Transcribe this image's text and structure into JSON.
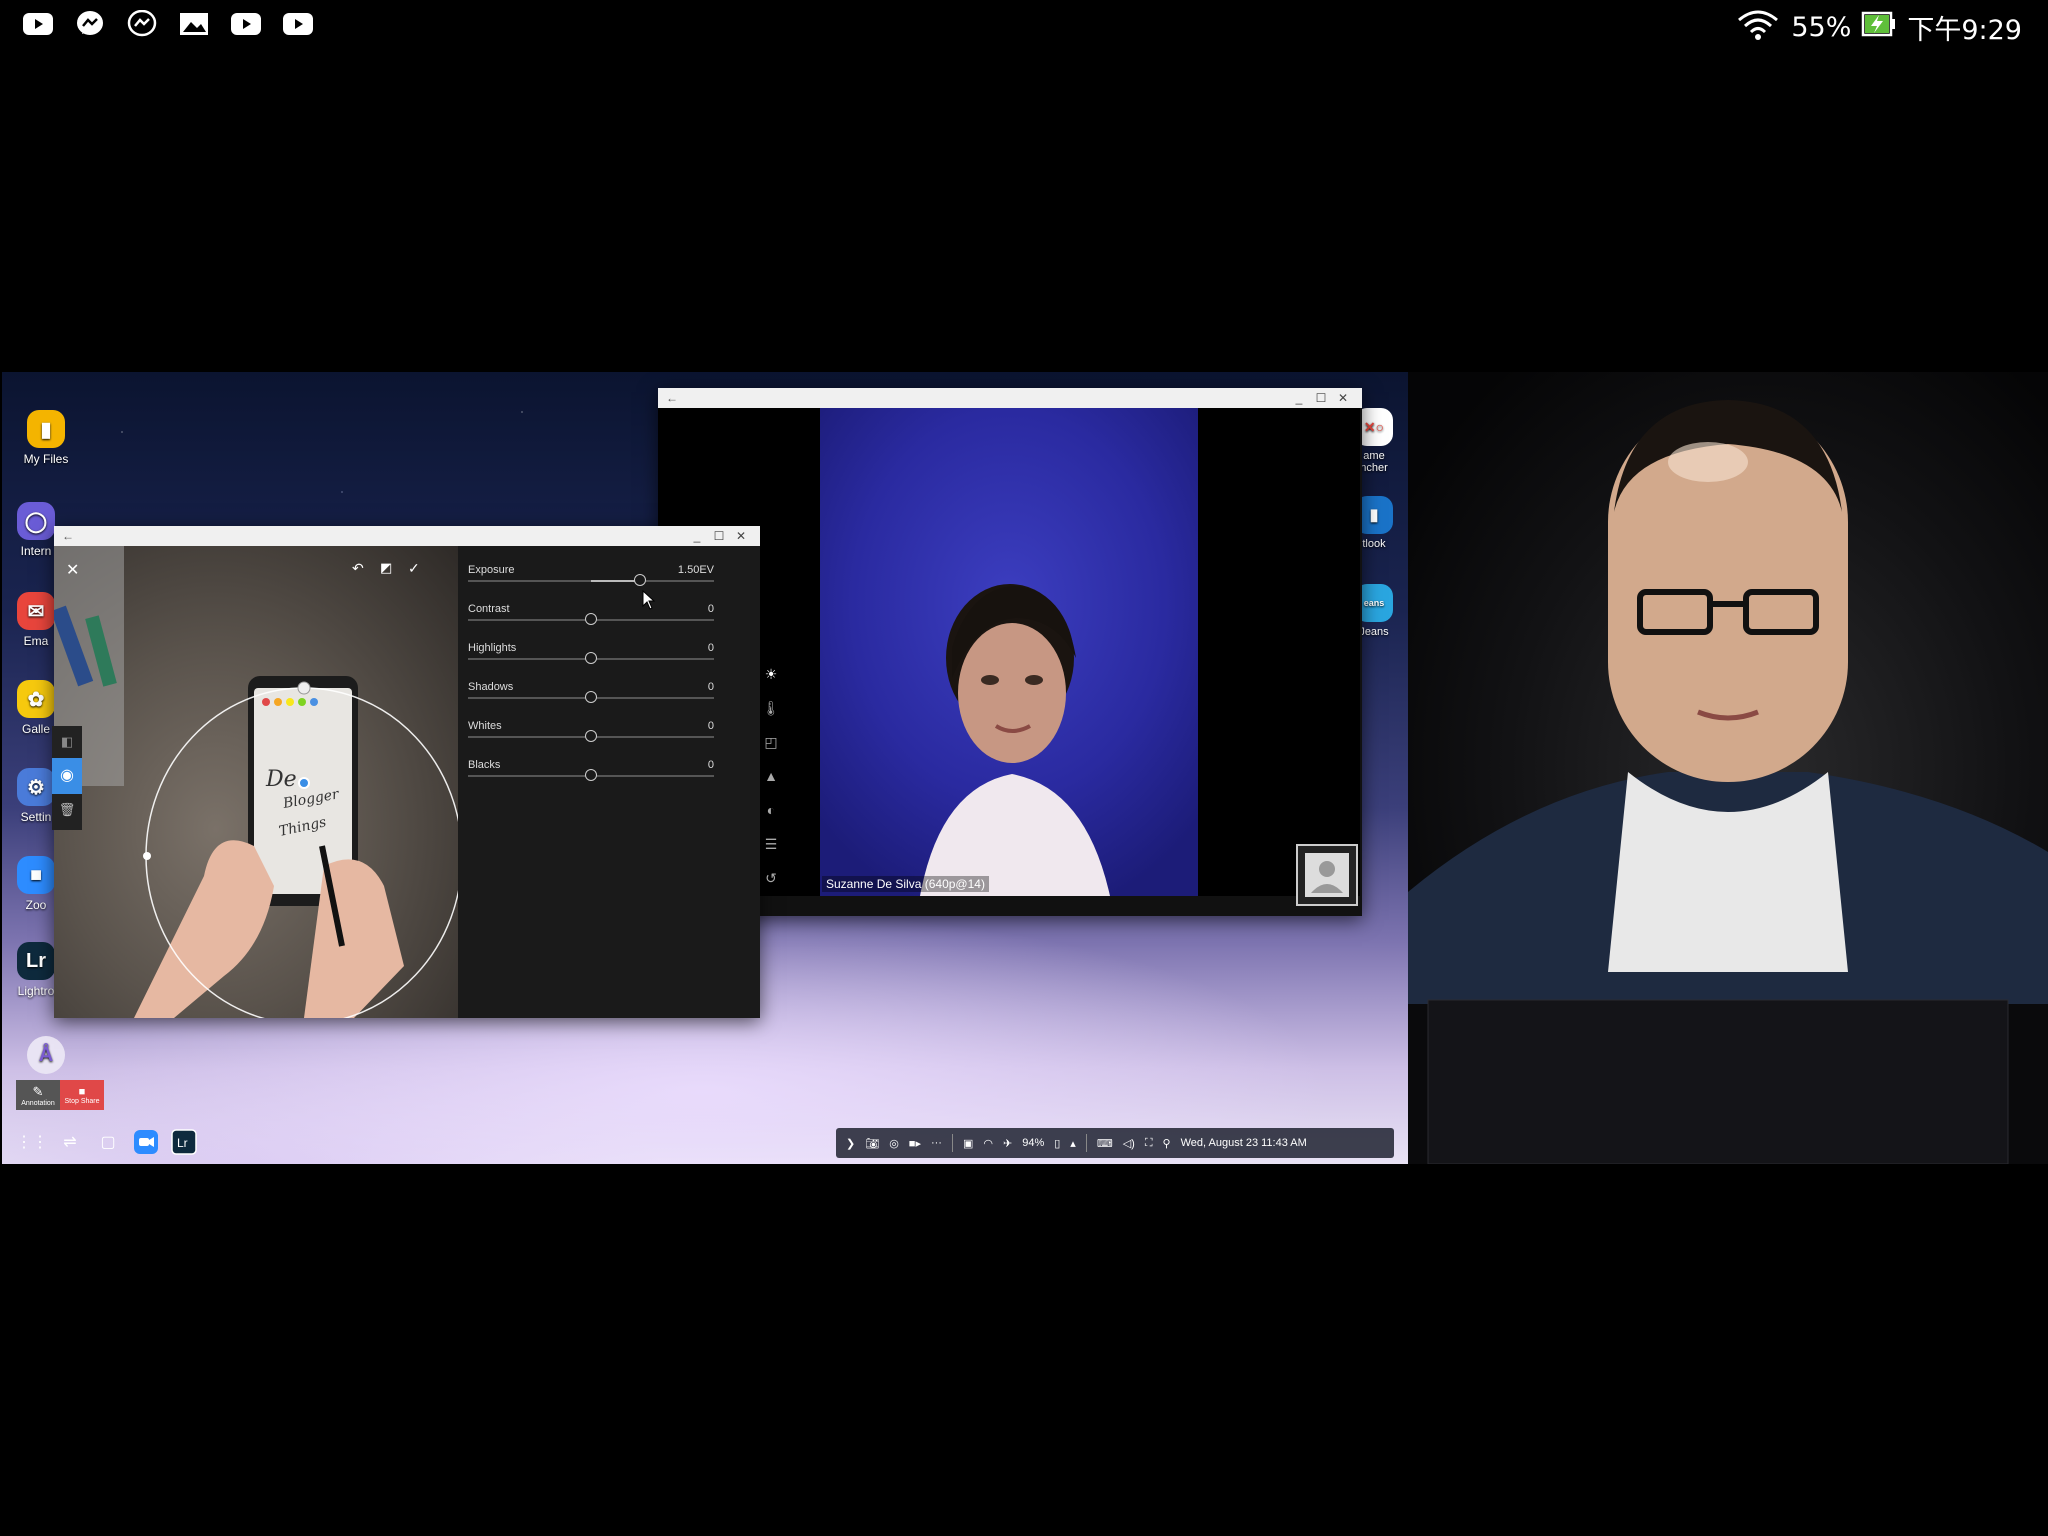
{
  "statusbar": {
    "notif_icons": [
      "youtube-icon",
      "messenger-icon",
      "messenger-icon",
      "gallery-icon",
      "youtube-icon",
      "youtube-icon"
    ],
    "battery": "55%",
    "time": "下午9:29"
  },
  "desktop": {
    "icons": [
      {
        "label": "My Files",
        "color": "#f4b400"
      },
      {
        "label": "Intern",
        "color": "#6a5cd6"
      },
      {
        "label": "Ema",
        "color": "#e8453c"
      },
      {
        "label": "Galle",
        "color": "#f6c90e"
      },
      {
        "label": "Settin",
        "color": "#4a7bd9"
      },
      {
        "label": "Zoo",
        "color": "#2d8cff"
      },
      {
        "label": "Lightro",
        "color": "#0e2a3d"
      }
    ],
    "right_icons": [
      {
        "label": "ame\nncher"
      },
      {
        "label": "tlook"
      },
      {
        "label": "Jeans"
      }
    ],
    "share": {
      "annotate": "Annotation",
      "stop": "Stop Share"
    },
    "taskbar": {
      "battery": "94%",
      "datetime": "Wed, August 23  11:43 AM"
    }
  },
  "lightroom": {
    "sliders": [
      {
        "label": "Exposure",
        "value": "1.50EV",
        "level": 0.7
      },
      {
        "label": "Contrast",
        "value": "0",
        "level": 0.5
      },
      {
        "label": "Highlights",
        "value": "0",
        "level": 0.5
      },
      {
        "label": "Shadows",
        "value": "0",
        "level": 0.5
      },
      {
        "label": "Whites",
        "value": "0",
        "level": 0.5
      },
      {
        "label": "Blacks",
        "value": "0",
        "level": 0.5
      }
    ]
  },
  "videocall": {
    "caption": "Suzanne De Silva (640p@14)"
  }
}
